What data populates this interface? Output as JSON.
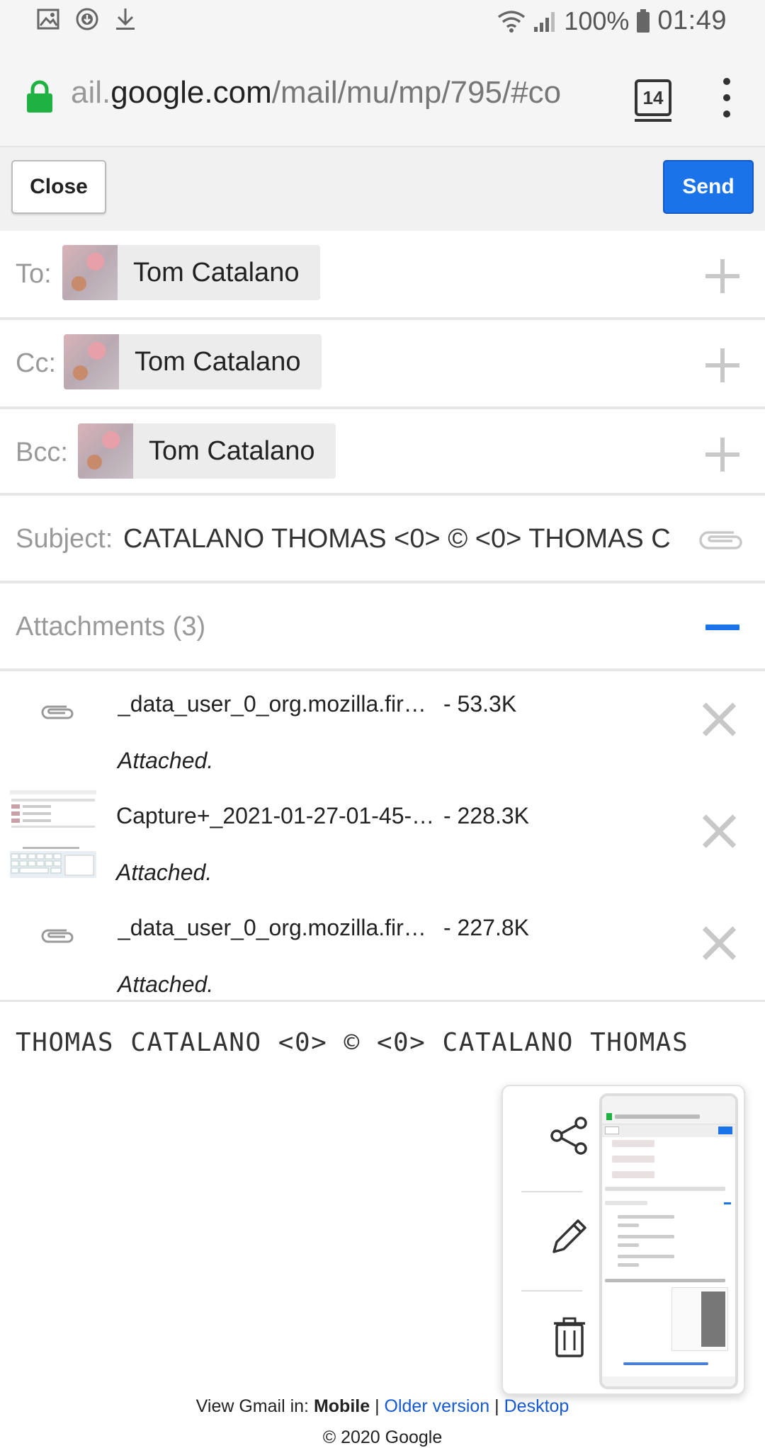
{
  "status_bar": {
    "battery": "100%",
    "time": "01:49"
  },
  "browser": {
    "url_prefix": "ail.",
    "url_host": "google.com",
    "url_path": "/mail/mu/mp/795/#co",
    "tab_count": "14"
  },
  "toolbar": {
    "close_label": "Close",
    "send_label": "Send",
    "send_color": "#1a73e8"
  },
  "recipients": {
    "to": {
      "label": "To:",
      "name": "Tom Catalano"
    },
    "cc": {
      "label": "Cc:",
      "name": "Tom Catalano"
    },
    "bcc": {
      "label": "Bcc:",
      "name": "Tom Catalano"
    }
  },
  "subject": {
    "label": "Subject:",
    "value": "CATALANO THOMAS <0> © <0> THOMAS C"
  },
  "attachments": {
    "heading": "Attachments (3)",
    "items": [
      {
        "name": "_data_user_0_org.mozilla.fir…",
        "size": "- 53.3K",
        "status": "Attached.",
        "icon": "paperclip-icon"
      },
      {
        "name": "Capture+_2021-01-27-01-45-…",
        "size": "- 228.3K",
        "status": "Attached.",
        "icon": "image-thumbnail"
      },
      {
        "name": "_data_user_0_org.mozilla.fir…",
        "size": "- 227.8K",
        "status": "Attached.",
        "icon": "paperclip-icon"
      }
    ]
  },
  "body": {
    "text": "THOMAS CATALANO <0> © <0> CATALANO THOMAS"
  },
  "screenshot_overlay": {
    "actions": [
      "share-icon",
      "edit-icon",
      "delete-icon"
    ]
  },
  "footer": {
    "prefix": "View Gmail in:",
    "mobile": "Mobile",
    "older": "Older version",
    "desktop": "Desktop",
    "separator": "|",
    "copyright": "© 2020 Google"
  }
}
